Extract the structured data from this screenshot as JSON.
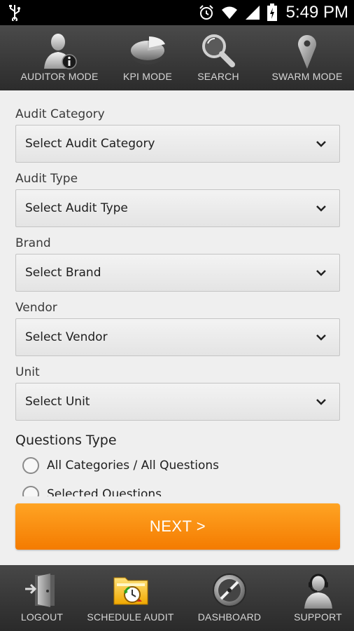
{
  "status_bar": {
    "time": "5:49 PM"
  },
  "top_nav": {
    "items": [
      {
        "label": "AUDITOR MODE",
        "icon": "auditor-icon"
      },
      {
        "label": "KPI MODE",
        "icon": "pie-chart-icon"
      },
      {
        "label": "SEARCH",
        "icon": "search-icon"
      },
      {
        "label": "SWARM MODE",
        "icon": "map-pin-icon"
      }
    ]
  },
  "form": {
    "fields": [
      {
        "label": "Audit Category",
        "placeholder": "Select Audit Category"
      },
      {
        "label": "Audit Type",
        "placeholder": "Select Audit Type"
      },
      {
        "label": "Brand",
        "placeholder": "Select Brand"
      },
      {
        "label": "Vendor",
        "placeholder": "Select Vendor"
      },
      {
        "label": "Unit",
        "placeholder": "Select Unit"
      }
    ],
    "questions_type": {
      "title": "Questions Type",
      "options": [
        {
          "label": "All Categories / All Questions"
        },
        {
          "label": "Selected Questions"
        }
      ]
    }
  },
  "next_button": {
    "label": "NEXT >"
  },
  "bottom_nav": {
    "items": [
      {
        "label": "LOGOUT",
        "icon": "logout-door-icon"
      },
      {
        "label": "SCHEDULE AUDIT",
        "icon": "schedule-folder-icon"
      },
      {
        "label": "DASHBOARD",
        "icon": "dashboard-compass-icon"
      },
      {
        "label": "SUPPORT",
        "icon": "support-headset-icon"
      }
    ]
  },
  "colors": {
    "accent": "#f47b00",
    "accent_light": "#ffa424",
    "bar_bg": "#333333"
  }
}
